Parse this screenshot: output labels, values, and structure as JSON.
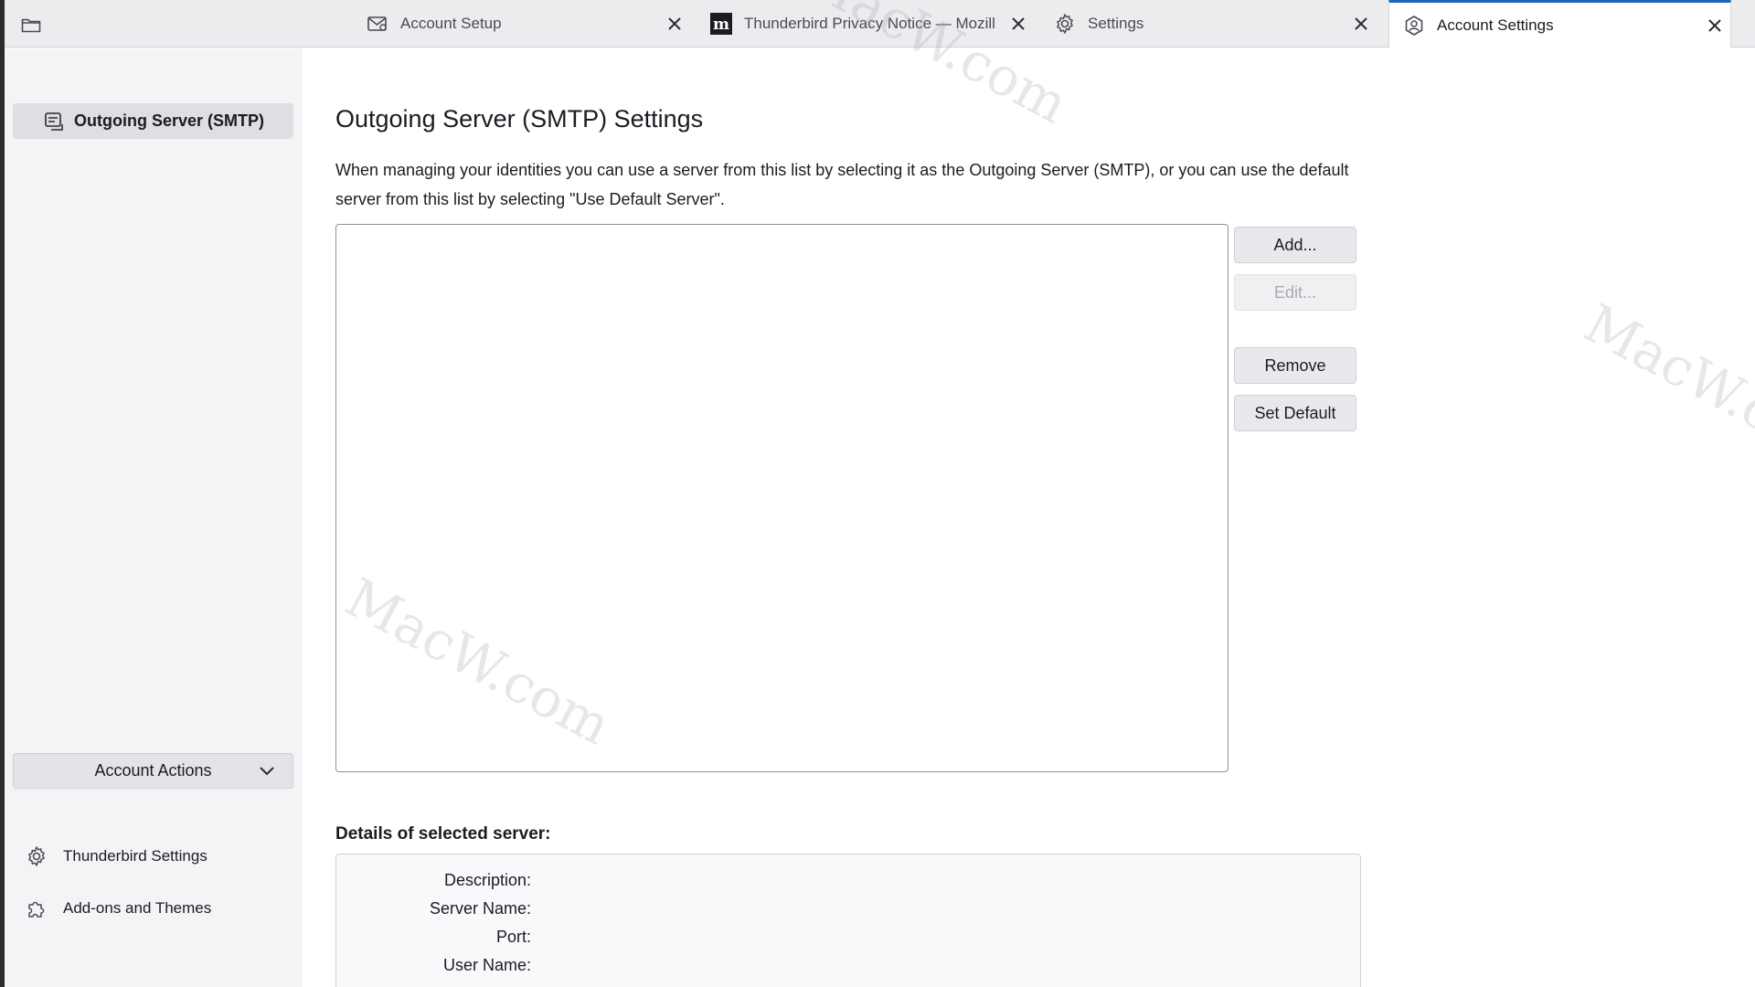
{
  "tabs": [
    {
      "label": "Account Setup",
      "icon": "envelope-gear-icon"
    },
    {
      "label": "Thunderbird Privacy Notice — Mozill",
      "icon": "mozilla-m-icon"
    },
    {
      "label": "Settings",
      "icon": "gear-icon"
    },
    {
      "label": "Account Settings",
      "icon": "account-settings-icon",
      "active": true
    }
  ],
  "sidebar": {
    "selected_item": "Outgoing Server (SMTP)",
    "account_actions": "Account Actions",
    "links": [
      {
        "label": "Thunderbird Settings",
        "icon": "gear-icon"
      },
      {
        "label": "Add-ons and Themes",
        "icon": "puzzle-icon"
      }
    ]
  },
  "main": {
    "title": "Outgoing Server (SMTP) Settings",
    "description": "When managing your identities you can use a server from this list by selecting it as the Outgoing Server (SMTP), or you can use the default server from this list by selecting \"Use Default Server\".",
    "buttons": {
      "add": "Add...",
      "edit": "Edit...",
      "remove": "Remove",
      "set_default": "Set Default"
    },
    "details_heading": "Details of selected server:",
    "details": {
      "description": "Description:",
      "server_name": "Server Name:",
      "port": "Port:",
      "user_name": "User Name:"
    }
  },
  "watermark": "MacW.com",
  "colors": {
    "accent": "#0b6cd1",
    "sidebar_bg": "#f4f4f6",
    "tabbar_bg": "#ececee"
  }
}
